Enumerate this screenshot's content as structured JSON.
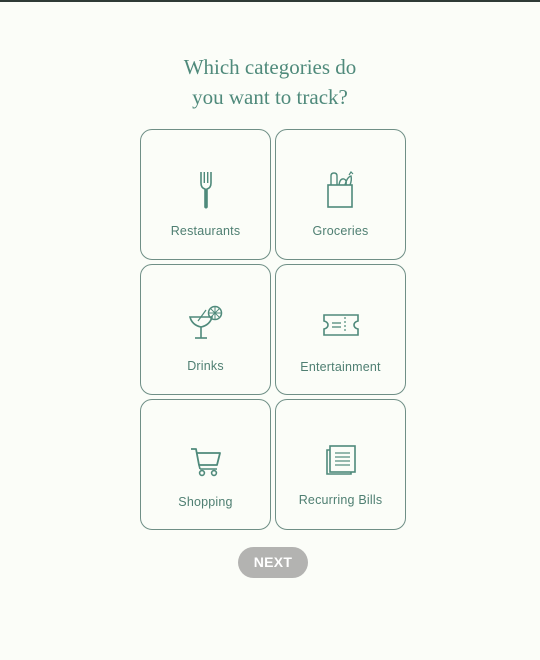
{
  "title": {
    "line1": "Which categories do",
    "line2": "you want to track?"
  },
  "categories": [
    {
      "label": "Restaurants",
      "icon": "fork-icon"
    },
    {
      "label": "Groceries",
      "icon": "grocery-bag-icon"
    },
    {
      "label": "Drinks",
      "icon": "cocktail-icon"
    },
    {
      "label": "Entertainment",
      "icon": "ticket-icon"
    },
    {
      "label": "Shopping",
      "icon": "shopping-cart-icon"
    },
    {
      "label": "Recurring Bills",
      "icon": "bills-document-icon"
    }
  ],
  "next_button": {
    "label": "NEXT"
  },
  "colors": {
    "accent": "#4f8a7b",
    "tile_border": "#6f8f86",
    "background": "#fbfdf8",
    "button_disabled": "#b3b3b1"
  }
}
